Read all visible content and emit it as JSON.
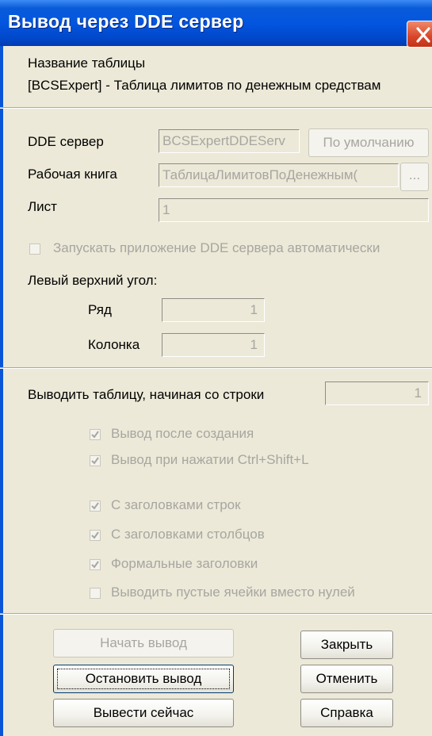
{
  "window": {
    "title": "Вывод через DDE сервер"
  },
  "table_name": {
    "label": "Название таблицы",
    "value": "[BCSExpert] - Таблица лимитов по денежным средствам"
  },
  "dde_server": {
    "label": "DDE сервер",
    "value": "BCSExpertDDEServ",
    "default_button": "По умолчанию"
  },
  "workbook": {
    "label": "Рабочая книга",
    "value": "ТаблицаЛимитовПоДенежным(",
    "browse_button": "..."
  },
  "sheet": {
    "label": "Лист",
    "value": "1"
  },
  "autostart_checkbox": {
    "label": "Запускать приложение DDE сервера автоматически",
    "checked": false
  },
  "top_left": {
    "label": "Левый верхний угол:",
    "row_label": "Ряд",
    "row_value": "1",
    "col_label": "Колонка",
    "col_value": "1"
  },
  "start_row": {
    "label": "Выводить таблицу,  начиная со строки",
    "value": "1"
  },
  "options": [
    {
      "label": "Вывод после создания",
      "checked": true
    },
    {
      "label": "Вывод при нажатии Ctrl+Shift+L",
      "checked": true
    },
    {
      "label": "С заголовками строк",
      "checked": true
    },
    {
      "label": "С заголовками столбцов",
      "checked": true
    },
    {
      "label": "Формальные заголовки",
      "checked": true
    },
    {
      "label": "Выводить пустые ячейки вместо нулей",
      "checked": false
    }
  ],
  "buttons": {
    "start": "Начать вывод",
    "stop": "Остановить вывод",
    "now": "Вывести сейчас",
    "close": "Закрыть",
    "cancel": "Отменить",
    "help": "Справка"
  },
  "colors": {
    "title_bar": "#0355e0",
    "dialog_bg": "#ece9d8",
    "disabled_text": "#a7a6a0",
    "close_button": "#d9462b"
  }
}
